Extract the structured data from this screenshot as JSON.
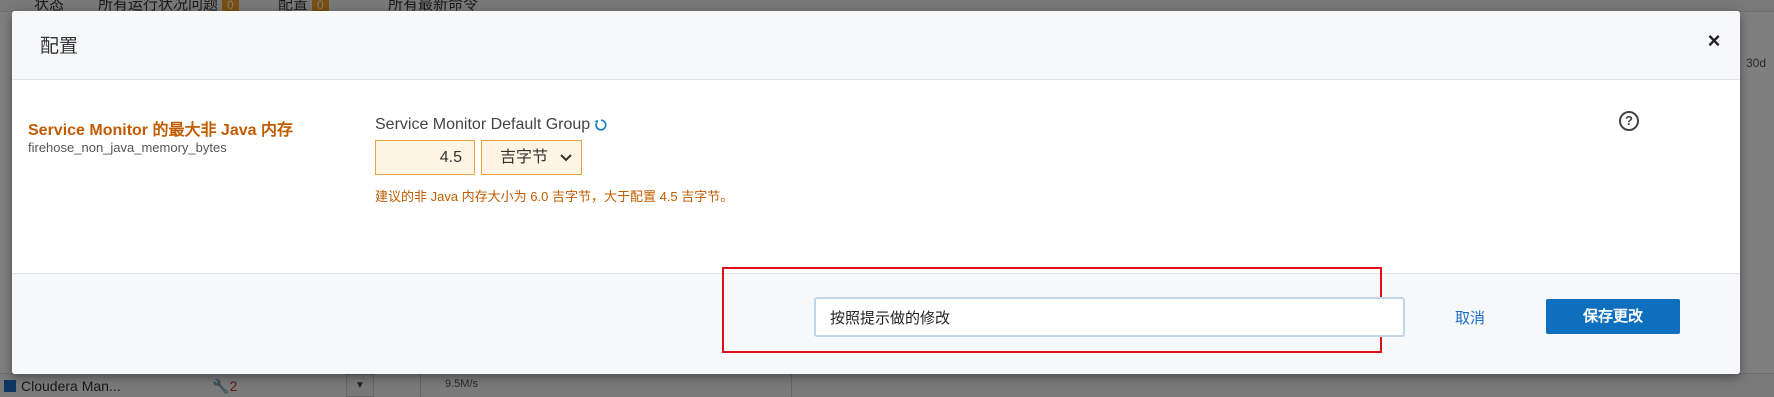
{
  "background": {
    "topbar_items": [
      {
        "label": "状态"
      },
      {
        "label": "所有运行状况问题",
        "badge": "0"
      },
      {
        "label": "配置",
        "badge": "0"
      },
      {
        "label": "所有最新命令"
      }
    ],
    "right_text": "30d",
    "bottom_service": "Cloudera Man...",
    "bottom_issue_count": "2",
    "chart_tick": "9.5M/s"
  },
  "modal": {
    "title": "配置",
    "close_glyph": "×",
    "property": {
      "label": "Service Monitor 的最大非 Java 内存",
      "key": "firehose_non_java_memory_bytes",
      "group": "Service Monitor Default Group",
      "value": "4.5",
      "unit": "吉字节",
      "warning": "建议的非 Java 内存大小为 6.0 吉字节，大于配置 4.5 吉字节。"
    },
    "help_glyph": "?",
    "footer": {
      "reason_value": "按照提示做的修改",
      "cancel_label": "取消",
      "save_label": "保存更改"
    }
  },
  "colors": {
    "accent": "#0e6fbf",
    "warning": "#c15c00",
    "highlight": "#e0101a"
  }
}
